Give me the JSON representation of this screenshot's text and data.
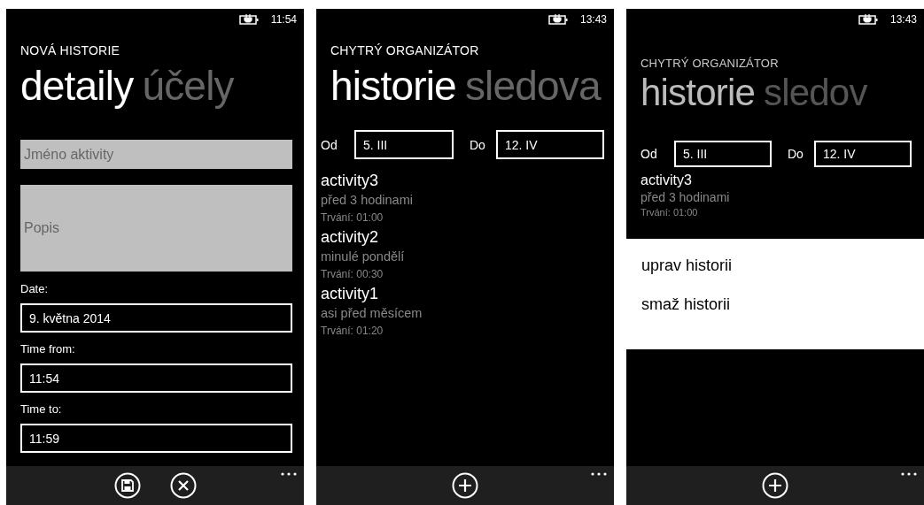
{
  "screens": [
    {
      "kind": "form",
      "dimmed": false,
      "status_time": "11:54",
      "title": "NOVÁ HISTORIE",
      "pivots": [
        {
          "label": "detaily",
          "selected": true
        },
        {
          "label": "účely",
          "selected": false
        }
      ],
      "fields": [
        {
          "kind": "text",
          "placeholder": "Jméno aktivity"
        },
        {
          "kind": "multiline",
          "placeholder": "Popis"
        },
        {
          "kind": "labeled",
          "label": "Date:",
          "value": "9. května 2014"
        },
        {
          "kind": "labeled",
          "label": "Time from:",
          "value": "11:54"
        },
        {
          "kind": "labeled",
          "label": "Time to:",
          "value": "11:59"
        }
      ],
      "app_bar": [
        {
          "kind": "save"
        },
        {
          "kind": "cancel"
        }
      ]
    },
    {
      "kind": "history",
      "dimmed": false,
      "status_time": "13:43",
      "title": "CHYTRÝ ORGANIZÁTOR",
      "pivots": [
        {
          "label": "historie",
          "selected": true
        },
        {
          "label": "sledova",
          "selected": false
        }
      ],
      "filter": {
        "from_label": "Od",
        "from": "5. III",
        "to_label": "Do",
        "to": "12. IV"
      },
      "items": [
        {
          "name": "activity3",
          "when": "před 3 hodinami",
          "duration": "Trvání: 01:00"
        },
        {
          "name": "activity2",
          "when": "minulé pondělí",
          "duration": "Trvání: 00:30"
        },
        {
          "name": "activity1",
          "when": "asi před měsícem",
          "duration": "Trvání: 01:20"
        }
      ],
      "app_bar": [
        {
          "kind": "add"
        }
      ]
    },
    {
      "kind": "history",
      "dimmed": true,
      "status_time": "13:43",
      "title": "CHYTRÝ ORGANIZÁTOR",
      "pivots": [
        {
          "label": "historie",
          "selected": true
        },
        {
          "label": "sledov",
          "selected": false
        }
      ],
      "filter": {
        "from_label": "Od",
        "from": "5. III",
        "to_label": "Do",
        "to": "12. IV"
      },
      "items": [
        {
          "name": "activity3",
          "when": "před 3 hodinami",
          "duration": "Trvání: 01:00"
        }
      ],
      "context_menu": [
        "uprav historii",
        "smaž historii"
      ],
      "app_bar": [
        {
          "kind": "add"
        }
      ]
    }
  ]
}
